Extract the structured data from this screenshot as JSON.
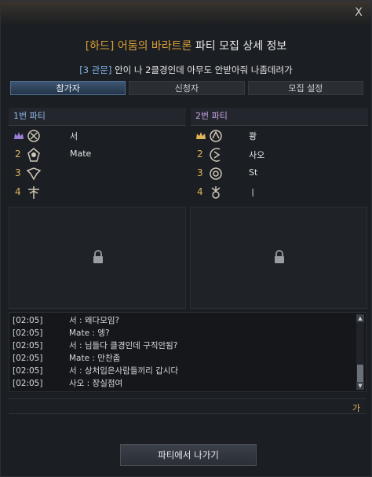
{
  "window": {
    "close_label": "X"
  },
  "header": {
    "difficulty": "[하드]",
    "dungeon": "어둠의 바라트론",
    "title_rest": "파티 모집 상세 정보",
    "gate_tag": "[3 관문]",
    "description": "안이 나 2클경인데 아무도 안받아줘 나좀데려가"
  },
  "tabs": [
    {
      "label": "참가자",
      "active": true
    },
    {
      "label": "신청자",
      "active": false
    },
    {
      "label": "모집 설정",
      "active": false
    }
  ],
  "parties": [
    {
      "title": "1번 파티",
      "members": [
        {
          "slot": "",
          "leader": true,
          "icon": "class-emblem-icon",
          "name": "서"
        },
        {
          "slot": "2",
          "leader": false,
          "icon": "class-emblem-icon",
          "name": "Mate"
        },
        {
          "slot": "3",
          "leader": false,
          "icon": "class-emblem-icon",
          "name": ""
        },
        {
          "slot": "4",
          "leader": false,
          "icon": "class-emblem-icon",
          "name": ""
        }
      ]
    },
    {
      "title": "2번 파티",
      "members": [
        {
          "slot": "",
          "leader": true,
          "icon": "class-emblem-icon",
          "name": "쾅"
        },
        {
          "slot": "2",
          "leader": false,
          "icon": "class-emblem-icon",
          "name": "사오"
        },
        {
          "slot": "3",
          "leader": false,
          "icon": "class-emblem-icon",
          "name": "St"
        },
        {
          "slot": "4",
          "leader": false,
          "icon": "class-emblem-icon",
          "name": "ㅣ"
        }
      ]
    }
  ],
  "chat": [
    {
      "time": "[02:05]",
      "text": "서 : 왜다모임?"
    },
    {
      "time": "[02:05]",
      "text": "Mate : 엥?"
    },
    {
      "time": "[02:05]",
      "text": "서 : 님들다 클경인데 구직안됨?"
    },
    {
      "time": "[02:05]",
      "text": "Mate : 만찬좀"
    },
    {
      "time": "[02:05]",
      "text": "서 : 상처입은사람들끼리 갑시다"
    },
    {
      "time": "[02:05]",
      "text": "사오 : 장실점여"
    }
  ],
  "input": {
    "ime_indicator": "가"
  },
  "footer": {
    "leave_label": "파티에서 나가기"
  },
  "colors": {
    "accent": "#d9a03a",
    "tab_active": "#3d5672",
    "party1": "#8fb8ea",
    "party2": "#c6a0e6"
  }
}
